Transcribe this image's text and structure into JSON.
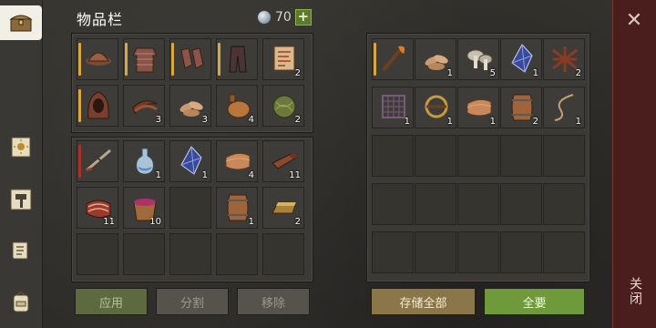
{
  "header": {
    "title": "物品栏",
    "currency_value": "70",
    "add_label": "+"
  },
  "sidebar": {
    "items": [
      {
        "name": "chest-icon",
        "active": true
      },
      {
        "name": "sun-book-icon",
        "active": false
      },
      {
        "name": "hammer-icon",
        "active": false
      },
      {
        "name": "scroll-icon",
        "active": false
      },
      {
        "name": "backpack-icon",
        "active": false
      }
    ]
  },
  "inventory": {
    "equipment": [
      {
        "icon": "leather-helmet-icon",
        "count": "",
        "gear": true
      },
      {
        "icon": "chainmail-armor-icon",
        "count": "",
        "gear": true
      },
      {
        "icon": "chain-gloves-icon",
        "count": "",
        "gear": true
      },
      {
        "icon": "leather-pants-icon",
        "count": "",
        "gear": true
      },
      {
        "icon": "recipe-scroll-icon",
        "count": "2",
        "gear": false
      },
      {
        "icon": "leather-hood-icon",
        "count": "",
        "gear": true
      },
      {
        "icon": "leather-strips-icon",
        "count": "3",
        "gear": false
      },
      {
        "icon": "plant-fiber-icon",
        "count": "3",
        "gear": false
      },
      {
        "icon": "water-flask-icon",
        "count": "4",
        "gear": false
      },
      {
        "icon": "fiber-ball-icon",
        "count": "2",
        "gear": false
      }
    ],
    "items": [
      {
        "icon": "crossbow-icon",
        "count": "",
        "mark": "red"
      },
      {
        "icon": "potion-bottle-icon",
        "count": "1",
        "mark": ""
      },
      {
        "icon": "blue-crystal-icon",
        "count": "1",
        "mark": ""
      },
      {
        "icon": "cloth-icon",
        "count": "4",
        "mark": ""
      },
      {
        "icon": "leather-roll-icon",
        "count": "11",
        "mark": ""
      },
      {
        "icon": "raw-meat-icon",
        "count": "11",
        "mark": ""
      },
      {
        "icon": "berry-bucket-icon",
        "count": "10",
        "mark": ""
      },
      {
        "icon": "",
        "count": "",
        "mark": ""
      },
      {
        "icon": "barrel-icon",
        "count": "1",
        "mark": ""
      },
      {
        "icon": "bronze-ingot-icon",
        "count": "2",
        "mark": ""
      }
    ],
    "buttons": {
      "apply": "应用",
      "split": "分割",
      "remove": "移除"
    }
  },
  "storage": {
    "items": [
      {
        "icon": "torch-icon",
        "count": "",
        "gear": true
      },
      {
        "icon": "plant-fiber-icon",
        "count": "1",
        "gear": false
      },
      {
        "icon": "mushroom-icon",
        "count": "5",
        "gear": false
      },
      {
        "icon": "blue-crystal-icon",
        "count": "1",
        "gear": false
      },
      {
        "icon": "leather-harness-icon",
        "count": "2",
        "gear": false
      },
      {
        "icon": "net-icon",
        "count": "1",
        "gear": false
      },
      {
        "icon": "trap-bow-icon",
        "count": "1",
        "gear": false
      },
      {
        "icon": "cloth-icon",
        "count": "1",
        "gear": false
      },
      {
        "icon": "barrel-icon",
        "count": "2",
        "gear": false
      },
      {
        "icon": "rope-icon",
        "count": "1",
        "gear": false
      }
    ],
    "buttons": {
      "store_all": "存储全部",
      "take_all": "全要"
    }
  },
  "close": {
    "label": "关闭"
  },
  "colors": {
    "gear_marker": "#d9a640",
    "broken_marker": "#a8322a",
    "accent_green": "#6f9a3b"
  }
}
